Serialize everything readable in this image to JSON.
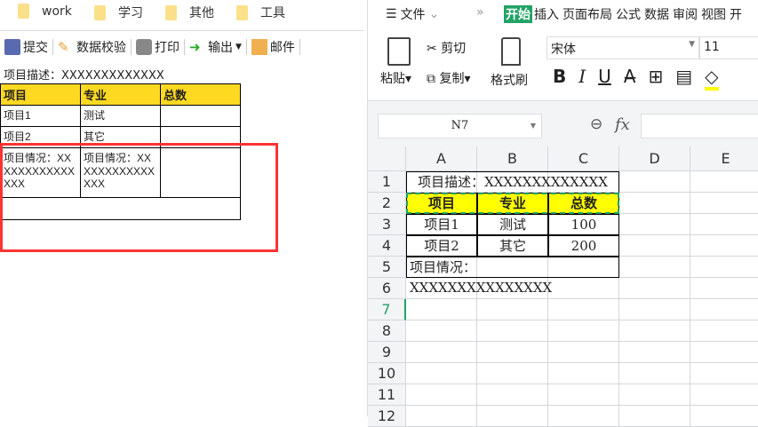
{
  "folders": [
    "work",
    "学习",
    "其他",
    "工具"
  ],
  "toolbar": {
    "submit": "提交",
    "validate": "数据校验",
    "print": "打印",
    "export": "输出",
    "mail": "邮件"
  },
  "left": {
    "desc": "项目描述：XXXXXXXXXXXXX",
    "headers": [
      "项目",
      "专业",
      "总数"
    ],
    "rows": [
      [
        "项目1",
        "测试",
        ""
      ],
      [
        "项目2",
        "其它",
        ""
      ]
    ],
    "status_a": "项目情况：XXXXXXXXXXXXXXX",
    "status_b": "项目情况：XXXXXXXXXXXXXXX"
  },
  "menu": {
    "file": "文件",
    "tabs": [
      "开始",
      "插入",
      "页面布局",
      "公式",
      "数据",
      "审阅",
      "视图",
      "开"
    ]
  },
  "ribbon": {
    "paste": "粘贴",
    "cut": "剪切",
    "copy": "复制",
    "format_painter": "格式刷",
    "font": "宋体",
    "size": "11",
    "bold": "B",
    "italic": "I",
    "underline": "U"
  },
  "formula": {
    "cell_ref": "N7",
    "fx": "fx"
  },
  "sheet": {
    "cols": [
      "A",
      "B",
      "C",
      "D",
      "E"
    ],
    "rows": [
      "1",
      "2",
      "3",
      "4",
      "5",
      "6",
      "7",
      "8",
      "9",
      "10",
      "11",
      "12"
    ],
    "r1": "项目描述：XXXXXXXXXXXXX",
    "headers": [
      "项目",
      "专业",
      "总数"
    ],
    "data": [
      [
        "项目1",
        "测试",
        "100"
      ],
      [
        "项目2",
        "其它",
        "200"
      ]
    ],
    "r5": "项目情况：XXXXXXXXXXXXXXX"
  },
  "colors": {
    "accent": "#21a366",
    "header_yellow": "#ffff00",
    "left_header": "#fdd922",
    "red_box": "#ff3333"
  }
}
